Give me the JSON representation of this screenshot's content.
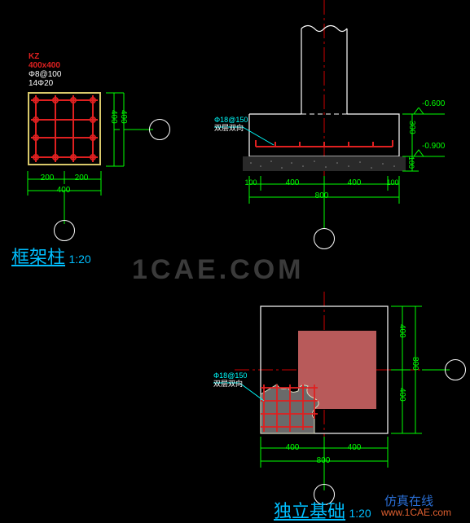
{
  "column": {
    "name": "KZ",
    "size": "400x400",
    "stirrup": "Φ8@100",
    "bars": "14Φ20",
    "dim_200a": "200",
    "dim_200b": "200",
    "dim_400b": "400",
    "dim_400r": "400",
    "dim_400rt": "400",
    "title": "框架柱",
    "scale": "1:20"
  },
  "footing_section": {
    "rebar_note": "Φ18@150",
    "rebar_sub": "双层双向",
    "elev_top": "-0.600",
    "elev_bot": "-0.900",
    "dim_100l": "100",
    "dim_400a": "400",
    "dim_400b": "400",
    "dim_100r": "100",
    "dim_800": "800",
    "dim_300": "300",
    "dim_100v": "100"
  },
  "footing_plan": {
    "rebar_note": "Φ18@150",
    "rebar_sub": "双层双向",
    "dim_400a": "400",
    "dim_400b": "400",
    "dim_800b": "800",
    "dim_400r1": "400",
    "dim_400r2": "400",
    "dim_800r": "800",
    "title": "独立基础",
    "scale": "1:20"
  },
  "watermark": {
    "main": "1CAE.COM",
    "sub1": "仿真在线",
    "sub2": "www.1CAE.com"
  }
}
